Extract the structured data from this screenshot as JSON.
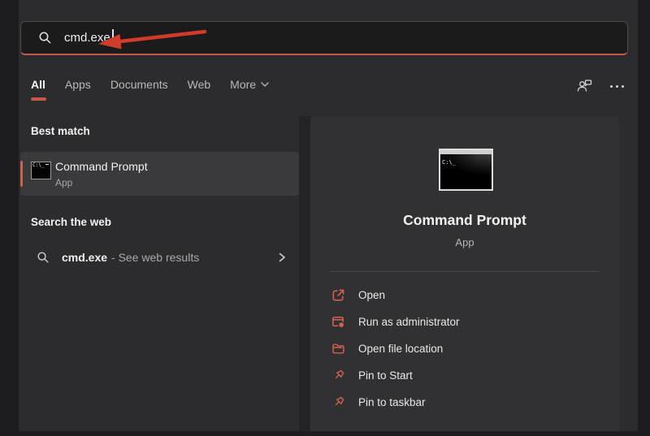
{
  "colors": {
    "accent": "#c75849",
    "action_icon": "#d4604f",
    "annotation_arrow": "#d13b2a",
    "panel_bg": "#313133",
    "window_bg": "#2c2c2e"
  },
  "icons": {
    "search": "magnifier-icon",
    "account": "account-icon",
    "more_options": "ellipsis-icon",
    "more_tab_chevron": "chevron-down-icon",
    "web_result_chevron": "chevron-right-icon",
    "cmd_glyph": "C:\\_"
  },
  "search": {
    "value": "cmd.exe"
  },
  "tabs": {
    "items": [
      {
        "label": "All",
        "selected": true
      },
      {
        "label": "Apps",
        "selected": false
      },
      {
        "label": "Documents",
        "selected": false
      },
      {
        "label": "Web",
        "selected": false
      },
      {
        "label": "More",
        "selected": false,
        "has_dropdown": true
      }
    ]
  },
  "best_match": {
    "heading": "Best match",
    "result": {
      "title": "Command Prompt",
      "subtitle": "App",
      "icon": "command-prompt-icon"
    }
  },
  "web_search": {
    "heading": "Search the web",
    "query": "cmd.exe",
    "suffix": "- See web results"
  },
  "preview": {
    "title": "Command Prompt",
    "subtitle": "App",
    "icon": "command-prompt-icon",
    "actions": [
      {
        "label": "Open",
        "icon": "open-external-icon"
      },
      {
        "label": "Run as administrator",
        "icon": "admin-window-icon"
      },
      {
        "label": "Open file location",
        "icon": "folder-icon"
      },
      {
        "label": "Pin to Start",
        "icon": "pin-icon"
      },
      {
        "label": "Pin to taskbar",
        "icon": "pin-icon"
      }
    ]
  }
}
